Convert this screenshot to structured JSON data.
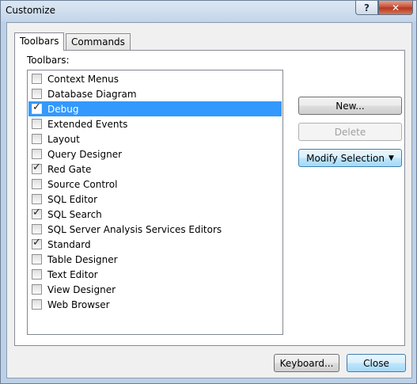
{
  "window": {
    "title": "Customize",
    "help_label": "?",
    "close_label": "✕"
  },
  "tabs": [
    {
      "label": "Toolbars",
      "active": true
    },
    {
      "label": "Commands",
      "active": false
    }
  ],
  "toolbars_panel": {
    "label": "Toolbars:",
    "items": [
      {
        "label": "Context Menus",
        "checked": false,
        "selected": false
      },
      {
        "label": "Database Diagram",
        "checked": false,
        "selected": false
      },
      {
        "label": "Debug",
        "checked": true,
        "selected": true
      },
      {
        "label": "Extended Events",
        "checked": false,
        "selected": false
      },
      {
        "label": "Layout",
        "checked": false,
        "selected": false
      },
      {
        "label": "Query Designer",
        "checked": false,
        "selected": false
      },
      {
        "label": "Red Gate",
        "checked": true,
        "selected": false
      },
      {
        "label": "Source Control",
        "checked": false,
        "selected": false
      },
      {
        "label": "SQL Editor",
        "checked": false,
        "selected": false
      },
      {
        "label": "SQL Search",
        "checked": true,
        "selected": false
      },
      {
        "label": "SQL Server Analysis Services Editors",
        "checked": false,
        "selected": false
      },
      {
        "label": "Standard",
        "checked": true,
        "selected": false
      },
      {
        "label": "Table Designer",
        "checked": false,
        "selected": false
      },
      {
        "label": "Text Editor",
        "checked": false,
        "selected": false
      },
      {
        "label": "View Designer",
        "checked": false,
        "selected": false
      },
      {
        "label": "Web Browser",
        "checked": false,
        "selected": false
      }
    ]
  },
  "buttons": {
    "new_label": "New...",
    "delete_label": "Delete",
    "modify_label": "Modify Selection",
    "keyboard_label": "Keyboard...",
    "close_label": "Close"
  },
  "colors": {
    "selection": "#3399ff",
    "close_button_red": "#c44a32"
  }
}
